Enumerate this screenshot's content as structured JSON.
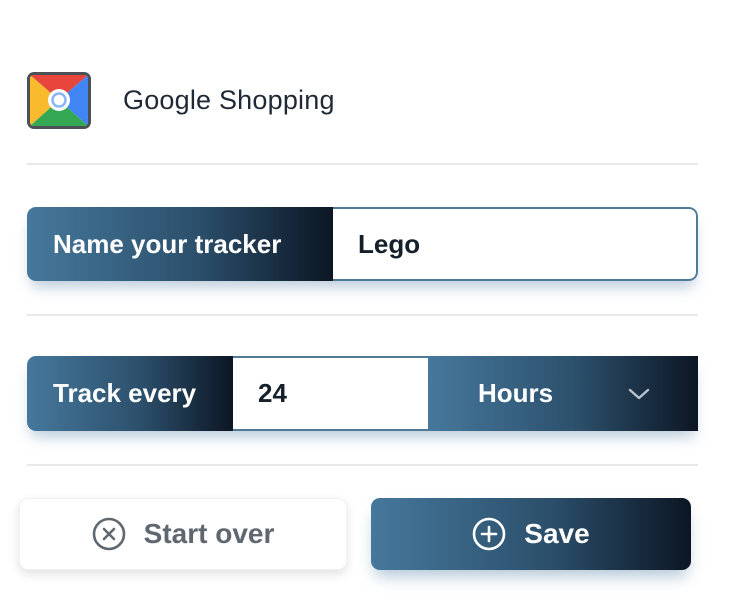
{
  "header": {
    "logo_icon": "google-shopping-logo-icon",
    "title": "Google Shopping"
  },
  "name_row": {
    "label": "Name your tracker",
    "value": "Lego"
  },
  "track_row": {
    "label": "Track every",
    "value": "24",
    "unit_selected": "Hours",
    "unit_icon": "chevron-down-icon"
  },
  "actions": {
    "start_over_label": "Start over",
    "start_over_icon": "close-circle-icon",
    "save_label": "Save",
    "save_icon": "plus-circle-icon"
  },
  "colors": {
    "gradient_start": "#46789c",
    "gradient_end": "#0c1624",
    "text_dark": "#15202b",
    "muted_text": "#5f6770"
  }
}
